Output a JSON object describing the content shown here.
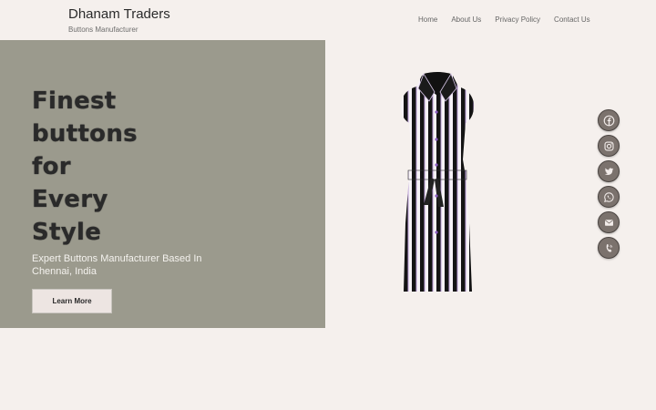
{
  "header": {
    "brand_title": "Dhanam Traders",
    "brand_tagline": "Buttons Manufacturer",
    "nav": [
      "Home",
      "About Us",
      "Privacy Policy",
      "Contact Us"
    ]
  },
  "hero": {
    "heading_lines": [
      "Finest",
      "buttons",
      "for",
      "Every",
      "Style"
    ],
    "subheading": "Expert Buttons Manufacturer Based In Chennai, India",
    "cta_label": "Learn More"
  },
  "image": {
    "subject": "striped sleeveless shirt dress with belt"
  },
  "social": [
    "facebook-icon",
    "instagram-icon",
    "twitter-icon",
    "whatsapp-icon",
    "email-icon",
    "phone-icon"
  ],
  "colors": {
    "background": "#f5f0ed",
    "hero_panel": "#9b9a8d",
    "button": "#ede5e2",
    "social_icon": "#7b726d"
  }
}
